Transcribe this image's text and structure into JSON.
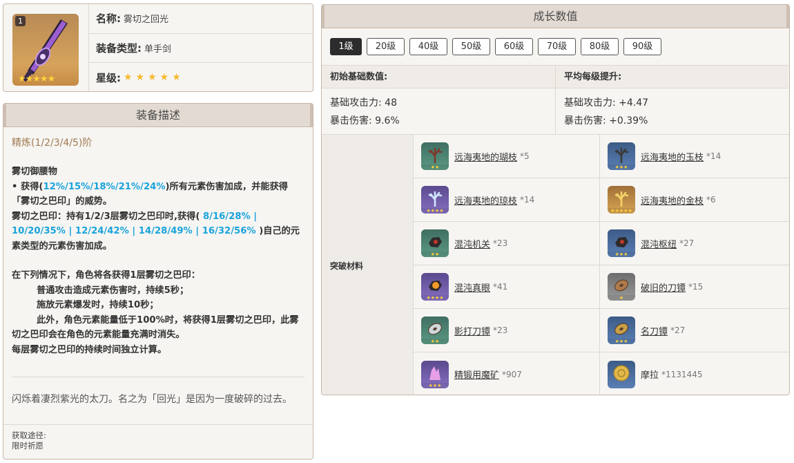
{
  "weapon": {
    "level_badge": "1",
    "icon_stars": "★★★★★",
    "name_label": "名称:",
    "name": "雾切之回光",
    "type_label": "装备类型:",
    "type": "单手剑",
    "rarity_label": "星级:",
    "rarity_stars": "★★★★★"
  },
  "description": {
    "header": "装备描述",
    "refine": "精炼(1/2/3/4/5)阶",
    "skill_name": "雾切御腰物",
    "line1_prefix": "• 获得(",
    "line1_values": "12%/15%/18%/21%/24%",
    "line1_suffix": ")所有元素伤害加成，并能获得「雾切之巴印」的威势。",
    "line2_prefix": "雾切之巴印：持有1/2/3层雾切之巴印时,获得(",
    "line2_values": " 8/16/28% | 10/20/35% | 12/24/42% | 14/28/49% | 16/32/56% ",
    "line2_suffix": ")自己的元素类型的元素伤害加成。",
    "line3": "在下列情况下，角色将各获得1层雾切之巴印：",
    "line4": "普通攻击造成元素伤害时，持续5秒；",
    "line5": "施放元素爆发时，持续10秒；",
    "line6": "此外，角色元素能量低于100%时，将获得1层雾切之巴印，此雾切之巴印会在角色的元素能量充满时消失。",
    "line7": "每层雾切之巴印的持续时间独立计算。",
    "flavor": "闪烁着凄烈紫光的太刀。名之为「回光」是因为一度破碎的过去。",
    "obtain_label": "获取途径:",
    "obtain_value": "限时祈愿"
  },
  "growth": {
    "header": "成长数值",
    "levels": [
      "1级",
      "20级",
      "40级",
      "50级",
      "60级",
      "70级",
      "80级",
      "90级"
    ],
    "active_level": "1级",
    "base_head": "初始基础数值:",
    "inc_head": "平均每级提升:",
    "base_atk": "基础攻击力: 48",
    "base_crit": "暴击伤害: 9.6%",
    "inc_atk": "基础攻击力: +4.47",
    "inc_crit": "暴击伤害: +0.39%",
    "materials_label": "突破材料",
    "materials": [
      {
        "name": "远海夷地的瑚枝",
        "count": "*5",
        "rarity": "r2",
        "stars": "★★",
        "icon": "coral-branch-icon",
        "color": "#7a3b2e"
      },
      {
        "name": "远海夷地的玉枝",
        "count": "*14",
        "rarity": "r3",
        "stars": "★★★",
        "icon": "jade-branch-icon",
        "color": "#3a3a3a"
      },
      {
        "name": "远海夷地的琼枝",
        "count": "*14",
        "rarity": "r4",
        "stars": "★★★★",
        "icon": "jeweled-branch-icon",
        "color": "#cfe6ff"
      },
      {
        "name": "远海夷地的金枝",
        "count": "*6",
        "rarity": "r5",
        "stars": "★★★★★",
        "icon": "golden-branch-icon",
        "color": "#f4d46a"
      },
      {
        "name": "混沌机关",
        "count": "*23",
        "rarity": "r2",
        "stars": "★★",
        "icon": "chaos-device-icon",
        "color": "#2e2a2a"
      },
      {
        "name": "混沌枢纽",
        "count": "*27",
        "rarity": "r3",
        "stars": "★★★",
        "icon": "chaos-circuit-icon",
        "color": "#2e2a2a"
      },
      {
        "name": "混沌真眼",
        "count": "*41",
        "rarity": "r4",
        "stars": "★★★★",
        "icon": "chaos-core-icon",
        "color": "#f29b2a"
      },
      {
        "name": "破旧的刀镡",
        "count": "*15",
        "rarity": "r1",
        "stars": "★",
        "icon": "old-handguard-icon",
        "color": "#b07a4a"
      },
      {
        "name": "影打刀镡",
        "count": "*23",
        "rarity": "r2",
        "stars": "★★",
        "icon": "kageuchi-handguard-icon",
        "color": "#cfd8dc"
      },
      {
        "name": "名刀镡",
        "count": "*27",
        "rarity": "r3",
        "stars": "★★★",
        "icon": "famed-handguard-icon",
        "color": "#c9a045"
      },
      {
        "name": "精锻用魔矿",
        "count": "*907",
        "rarity": "r4",
        "stars": "★★★",
        "icon": "mystic-ore-icon",
        "color": "#e7a0e8"
      },
      {
        "name": "摩拉",
        "count": "*1131445",
        "rarity": "r3",
        "stars": "",
        "icon": "mora-coin-icon",
        "color": "#e2b84a",
        "plain": true
      }
    ]
  }
}
